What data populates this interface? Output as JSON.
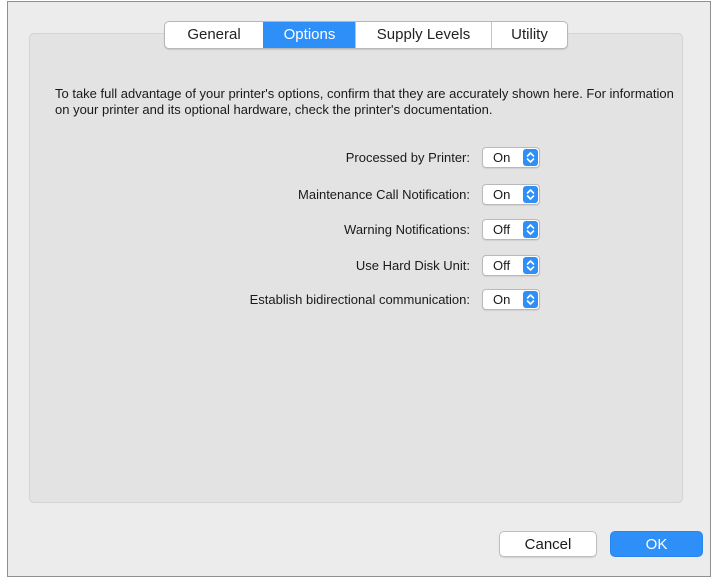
{
  "tabs": [
    {
      "label": "General",
      "active": false
    },
    {
      "label": "Options",
      "active": true
    },
    {
      "label": "Supply Levels",
      "active": false
    },
    {
      "label": "Utility",
      "active": false
    }
  ],
  "description": "To take full advantage of your printer's options, confirm that they are accurately shown here. For information on your printer and its optional hardware, check the printer's documentation.",
  "options": [
    {
      "label": "Processed by Printer:",
      "value": "On"
    },
    {
      "label": "Maintenance Call Notification:",
      "value": "On"
    },
    {
      "label": "Warning Notifications:",
      "value": "Off"
    },
    {
      "label": "Use Hard Disk Unit:",
      "value": "Off"
    },
    {
      "label": "Establish bidirectional communication:",
      "value": "On"
    }
  ],
  "buttons": {
    "cancel": "Cancel",
    "ok": "OK"
  },
  "colors": {
    "accent": "#2f8ff8",
    "window_bg": "#ececec",
    "panel_bg": "#e3e3e3"
  },
  "icons": {
    "popup_arrows": "chevron-up-down-icon"
  }
}
